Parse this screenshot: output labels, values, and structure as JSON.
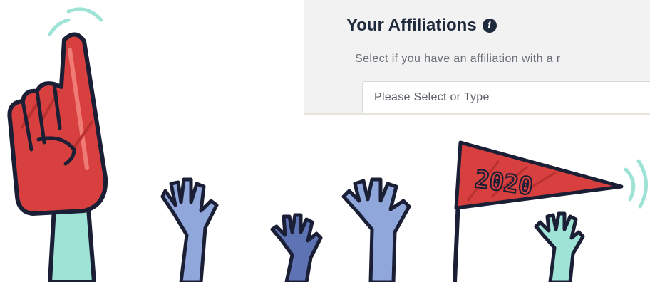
{
  "affiliations": {
    "title": "Your Affiliations",
    "info_icon": "info-icon",
    "description": "Select if you have an affiliation with a r",
    "select_value": "Please Select or Type"
  },
  "illustration": {
    "pennant_text": "2020"
  },
  "colors": {
    "panel_bg": "#f2f2f2",
    "title": "#1f2a3c",
    "red": "#d8403f",
    "teal": "#9fe3d7",
    "blue": "#8fa7db",
    "dark_blue": "#5d73b4",
    "outline": "#1b1f35"
  }
}
